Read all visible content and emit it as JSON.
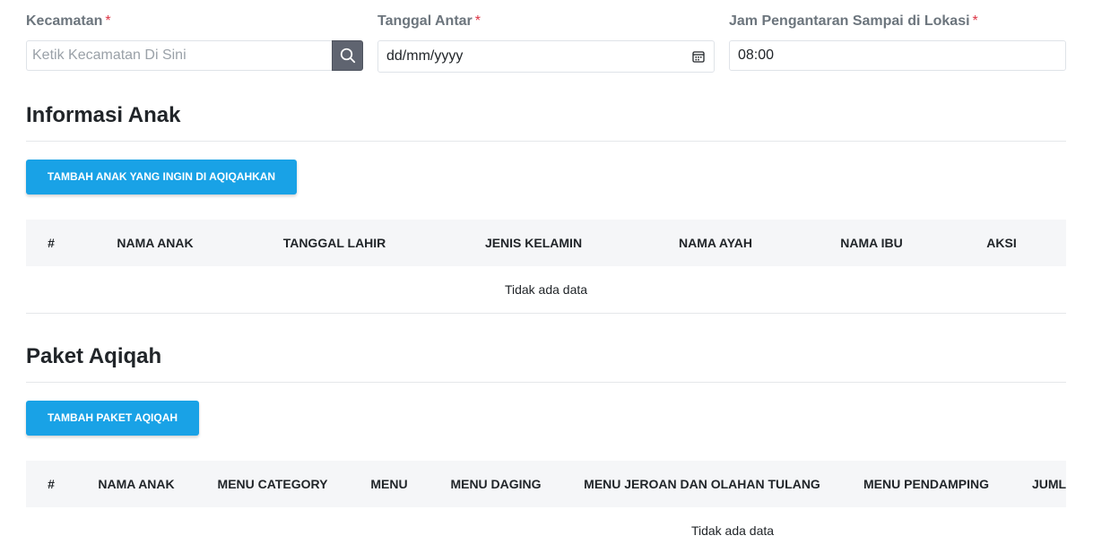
{
  "form": {
    "kecamatan": {
      "label": "Kecamatan",
      "required_mark": "*",
      "placeholder": "Ketik Kecamatan Di Sini",
      "value": ""
    },
    "tanggal_antar": {
      "label": "Tanggal Antar",
      "required_mark": "*",
      "value": "dd/mm/yyyy"
    },
    "jam": {
      "label": "Jam Pengantaran Sampai di Lokasi",
      "required_mark": "*",
      "value": "08:00"
    }
  },
  "informasi_anak": {
    "title": "Informasi Anak",
    "add_button": "TAMBAH ANAK YANG INGIN DI AQIQAHKAN",
    "columns": [
      "#",
      "NAMA ANAK",
      "TANGGAL LAHIR",
      "JENIS KELAMIN",
      "NAMA AYAH",
      "NAMA IBU",
      "AKSI"
    ],
    "empty_text": "Tidak ada data"
  },
  "paket_aqiqah": {
    "title": "Paket Aqiqah",
    "add_button": "TAMBAH PAKET AQIQAH",
    "columns": [
      "#",
      "NAMA ANAK",
      "MENU CATEGORY",
      "MENU",
      "MENU DAGING",
      "MENU JEROAN DAN OLAHAN TULANG",
      "MENU PENDAMPING",
      "JUML"
    ],
    "empty_text": "Tidak ada data"
  },
  "icons": {
    "search": "search-icon",
    "calendar": "calendar-icon"
  },
  "colors": {
    "primary_button": "#19a2e6",
    "search_button": "#5f6470",
    "required": "#dc3545",
    "table_header_bg": "#f5f6f8"
  }
}
